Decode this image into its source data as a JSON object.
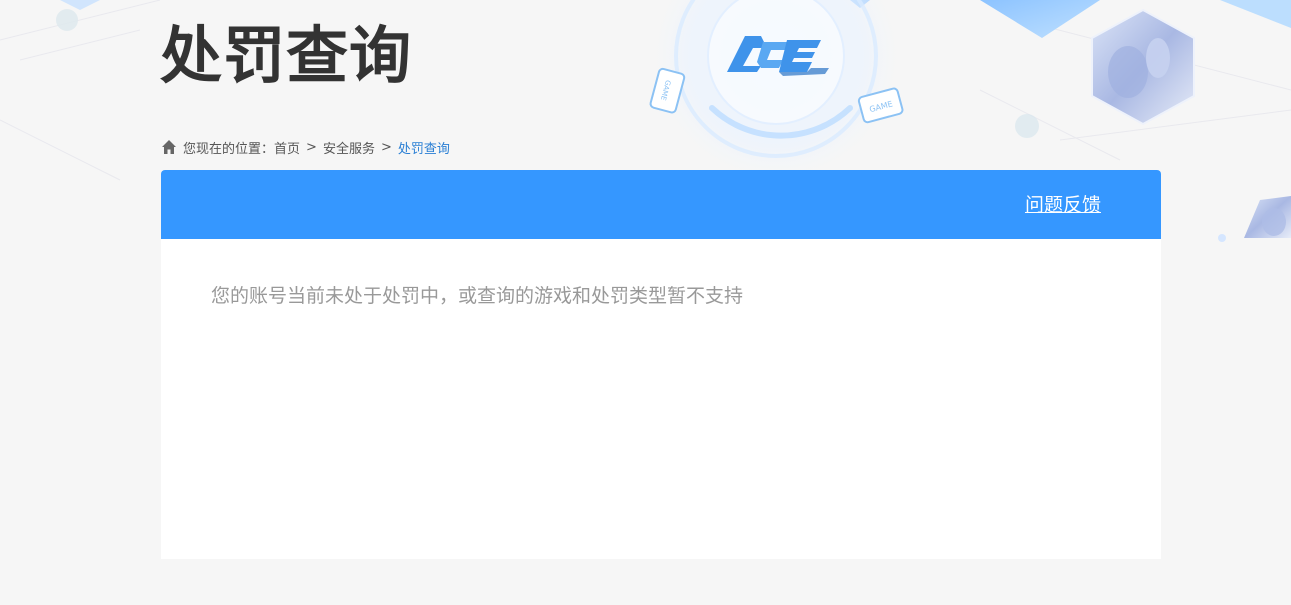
{
  "page": {
    "title": "处罚查询"
  },
  "breadcrumb": {
    "prefix": "您现在的位置：",
    "items": [
      "首页",
      "安全服务"
    ],
    "separator": ">",
    "current": "处罚查询"
  },
  "panel": {
    "feedback_link": "问题反馈",
    "message": "您的账号当前未处于处罚中，或查询的游戏和处罚类型暂不支持"
  },
  "logo": {
    "text": "ACE"
  },
  "badges": {
    "game": "GAME"
  },
  "colors": {
    "accent": "#3597ff",
    "breadcrumb_current": "#2a7fd4",
    "title": "#333333",
    "message": "#999999",
    "background": "#f6f6f6"
  },
  "icons": {
    "breadcrumb": "home-icon",
    "logo": "ace-logo",
    "decor": [
      "game-device-icon",
      "game-device-icon",
      "character-avatar",
      "character-avatar"
    ]
  }
}
